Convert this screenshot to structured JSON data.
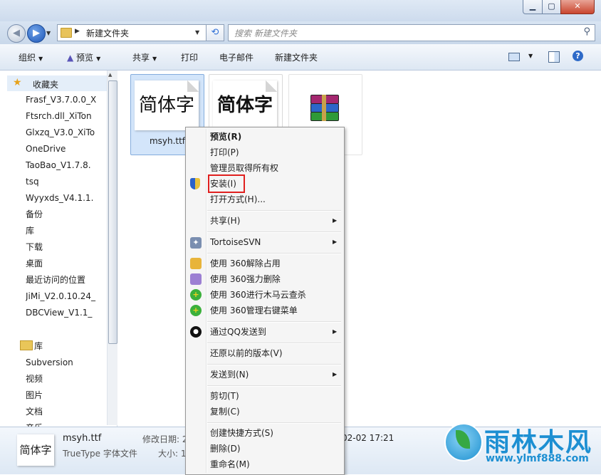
{
  "window": {
    "controls": [
      "▁",
      "▢",
      "✕"
    ]
  },
  "address": {
    "path": "新建文件夹",
    "search_placeholder": "搜索 新建文件夹"
  },
  "toolbar": {
    "organize": "组织",
    "preview": "预览",
    "share": "共享",
    "print": "打印",
    "email": "电子邮件",
    "new_folder": "新建文件夹"
  },
  "nav": {
    "favorites_label": "收藏夹",
    "favorites": [
      {
        "label": "Frasf_V3.7.0.0_X",
        "icon": "winrar-icon"
      },
      {
        "label": "Ftsrch.dll_XiTon",
        "icon": "winrar-icon"
      },
      {
        "label": "Glxzq_V3.0_XiTo",
        "icon": "winrar-icon"
      },
      {
        "label": "OneDrive",
        "icon": "onedrive-icon"
      },
      {
        "label": "TaoBao_V1.7.8.",
        "icon": "winrar-icon"
      },
      {
        "label": "tsq",
        "icon": "folder-icon"
      },
      {
        "label": "Wyyxds_V4.1.1.",
        "icon": "winrar-icon"
      },
      {
        "label": "备份",
        "icon": "folder-icon"
      },
      {
        "label": "库",
        "icon": "library-icon"
      },
      {
        "label": "下载",
        "icon": "downloads-icon"
      },
      {
        "label": "桌面",
        "icon": "desktop-icon"
      },
      {
        "label": "最近访问的位置",
        "icon": "recent-icon"
      },
      {
        "label": "JiMi_V2.0.10.24_",
        "icon": "winrar-icon"
      },
      {
        "label": "DBCView_V1.1_",
        "icon": "winrar-icon"
      }
    ],
    "libraries_label": "库",
    "libraries": [
      {
        "label": "Subversion",
        "icon": "library-icon"
      },
      {
        "label": "视频",
        "icon": "video-icon"
      },
      {
        "label": "图片",
        "icon": "pictures-icon"
      },
      {
        "label": "文档",
        "icon": "documents-icon"
      },
      {
        "label": "音乐",
        "icon": "music-icon"
      }
    ]
  },
  "files": [
    {
      "name": "msyh.ttf",
      "thumb": "简体字",
      "selected": true
    },
    {
      "name": "",
      "thumb": "简体字",
      "selected": false
    },
    {
      "name": "",
      "thumb": "",
      "selected": false
    }
  ],
  "context_menu": {
    "items": [
      {
        "label": "预览(R)",
        "bold": true
      },
      {
        "label": "打印(P)"
      },
      {
        "label": "管理员取得所有权"
      },
      {
        "label": "安装(I)",
        "icon": "shield-icon",
        "highlighted": true
      },
      {
        "label": "打开方式(H)..."
      },
      {
        "label": "共享(H)",
        "submenu": true
      },
      {
        "label": "TortoiseSVN",
        "icon": "tortoisesvn-icon",
        "submenu": true
      },
      {
        "label": "使用 360解除占用",
        "icon": "360-unlock-icon"
      },
      {
        "label": "使用 360强力删除",
        "icon": "360-delete-icon"
      },
      {
        "label": "使用 360进行木马云查杀",
        "icon": "360-scan-icon"
      },
      {
        "label": "使用 360管理右键菜单",
        "icon": "360-menu-icon"
      },
      {
        "label": "通过QQ发送到",
        "icon": "qq-icon",
        "submenu": true
      },
      {
        "label": "还原以前的版本(V)"
      },
      {
        "label": "发送到(N)",
        "submenu": true
      },
      {
        "label": "剪切(T)"
      },
      {
        "label": "复制(C)"
      },
      {
        "label": "创建快捷方式(S)"
      },
      {
        "label": "删除(D)"
      },
      {
        "label": "重命名(M)"
      }
    ]
  },
  "details": {
    "thumb": "简体字",
    "name": "msyh.ttf",
    "type": "TrueType 字体文件",
    "modified_label": "修改日期: 2",
    "modified_value": "02-02 17:21",
    "size_label": "大小: 1"
  },
  "watermark": {
    "title": "雨林木风",
    "url": "www.ylmf888.com"
  },
  "colors": {
    "selection": "#d3e5fa",
    "highlight_box": "#e0201f",
    "watermark": "#1d8fd2"
  }
}
